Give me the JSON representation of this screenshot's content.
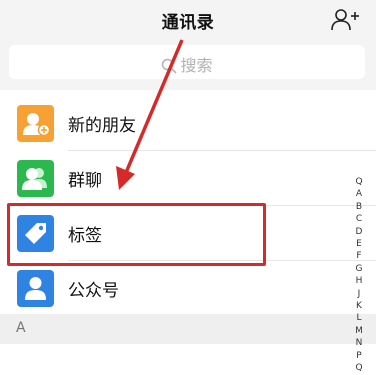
{
  "nav": {
    "title": "通讯录",
    "add_icon": "add-contact-icon"
  },
  "search": {
    "placeholder": "搜索"
  },
  "rows": [
    {
      "label": "新的朋友",
      "icon": "new-friends-icon",
      "color": "#f7a033"
    },
    {
      "label": "群聊",
      "icon": "group-chat-icon",
      "color": "#2bb84e"
    },
    {
      "label": "标签",
      "icon": "tag-icon",
      "color": "#2f84e3"
    },
    {
      "label": "公众号",
      "icon": "official-account-icon",
      "color": "#2f84e3"
    }
  ],
  "section": {
    "label": "A"
  },
  "index": {
    "search_glyph": "Q",
    "letters": [
      "A",
      "B",
      "C",
      "D",
      "E",
      "F",
      "G",
      "H",
      "J",
      "K",
      "L",
      "M",
      "N",
      "P",
      "Q"
    ]
  },
  "colors": {
    "annotation_red": "#d62a2a"
  }
}
